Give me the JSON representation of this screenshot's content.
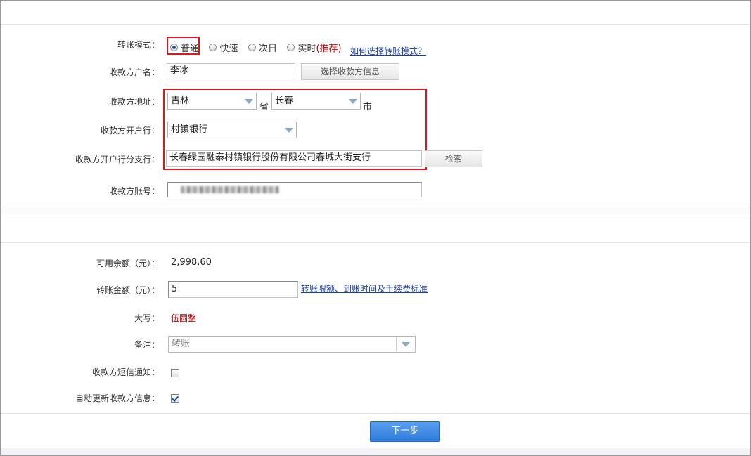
{
  "form": {
    "mode": {
      "label": "转账模式：",
      "options": [
        {
          "label": "普通",
          "selected": true
        },
        {
          "label": "快速",
          "selected": false
        },
        {
          "label": "次日",
          "selected": false
        },
        {
          "label": "实时",
          "selected": false
        }
      ],
      "recommend": "(推荐)",
      "help_link": "如何选择转账模式？"
    },
    "payee_name": {
      "label": "收款方户名：",
      "value": "李冰",
      "select_button": "选择收款方信息"
    },
    "payee_address": {
      "label": "收款方地址：",
      "province": "吉林",
      "province_suffix": "省",
      "city": "长春",
      "city_suffix": "市"
    },
    "payee_bank": {
      "label": "收款方开户行：",
      "value": "村镇银行"
    },
    "payee_branch": {
      "label": "收款方开户行分支行：",
      "value": "长春绿园融泰村镇银行股份有限公司春城大街支行",
      "search_button": "检索"
    },
    "payee_account": {
      "label": "收款方账号：",
      "masked": true
    }
  },
  "amount": {
    "balance_label": "可用余额（元）：",
    "balance_value": "2,998.60",
    "amount_label": "转账金额（元）：",
    "amount_value": "5",
    "limits_link": "转账限额、到账时间及手续费标准",
    "uppercase_label": "大写：",
    "uppercase_value": "伍圆整",
    "note_label": "备注：",
    "note_placeholder": "转账",
    "sms_label": "收款方短信通知：",
    "sms_checked": false,
    "auto_update_label": "自动更新收款方信息：",
    "auto_update_checked": true
  },
  "actions": {
    "next": "下一步"
  },
  "colors": {
    "highlight": "#d9181e",
    "link": "#1a3da8",
    "recommend": "#c00000",
    "uppercase": "#c00000",
    "primary": "#2f7adc"
  }
}
